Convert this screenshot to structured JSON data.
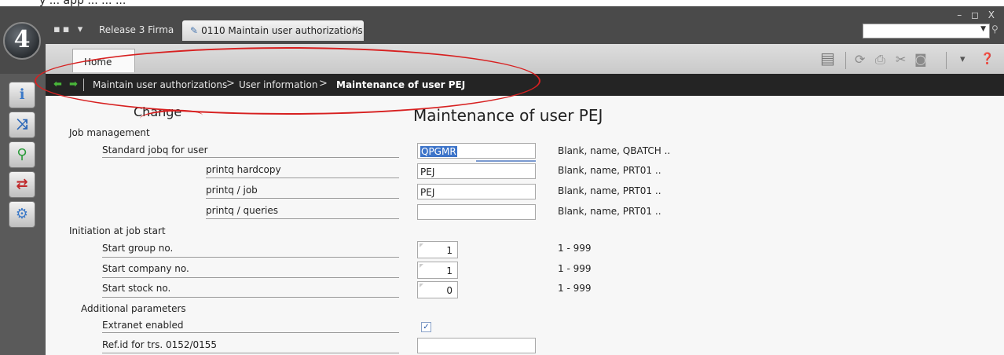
{
  "top_cut_text": "y ... app ... ... ...",
  "app": {
    "logo_text": "4"
  },
  "header": {
    "menu_icon": "grid-menu-icon",
    "release_label": "Release 3 Firma",
    "tab_label": "0110 Maintain user authorizations",
    "tab_close": "✕",
    "window_controls": "– ◻ X"
  },
  "ribbon": {
    "home_label": "Home",
    "icons": [
      "note-icon",
      "refresh-icon",
      "print-icon",
      "cut-icon",
      "window-icon",
      "chevron-down-icon",
      "help-icon"
    ]
  },
  "breadcrumb": {
    "items": [
      "Maintain user authorizations",
      "User information",
      "Maintenance of user PEJ"
    ],
    "separator": ">"
  },
  "sidebar": {
    "icons": [
      "info-icon",
      "shuffle-icon",
      "search-icon",
      "convert-icon",
      "settings-icon"
    ]
  },
  "main": {
    "mode": "Change",
    "title": "Maintenance of user PEJ",
    "sections": {
      "job_management": "Job management",
      "initiation": "Initiation at job start",
      "additional": "Additional parameters"
    },
    "fields": {
      "standard_jobq": {
        "label": "Standard jobq for user",
        "value": "QPGMR",
        "hint": "Blank, name, QBATCH .."
      },
      "printq_hardcopy": {
        "label": "printq hardcopy",
        "value": "PEJ",
        "hint": "Blank, name, PRT01 .."
      },
      "printq_job": {
        "label": "printq / job",
        "value": "PEJ",
        "hint": "Blank, name, PRT01 .."
      },
      "printq_queries": {
        "label": "printq / queries",
        "value": "",
        "hint": "Blank, name, PRT01 .."
      },
      "start_group": {
        "label": "Start group no.",
        "value": "1",
        "hint": "1 - 999"
      },
      "start_company": {
        "label": "Start company no.",
        "value": "1",
        "hint": "1 - 999"
      },
      "start_stock": {
        "label": "Start stock no.",
        "value": "0",
        "hint": "1 - 999"
      },
      "extranet": {
        "label": "Extranet enabled",
        "checked": true,
        "mark": "✓"
      },
      "ref_id": {
        "label": "Ref.id for trs.  0152/0155",
        "value": ""
      }
    }
  },
  "colors": {
    "accent_green": "#49b63a",
    "annotation_red": "#d72020",
    "selection_blue": "#3d74c9"
  }
}
